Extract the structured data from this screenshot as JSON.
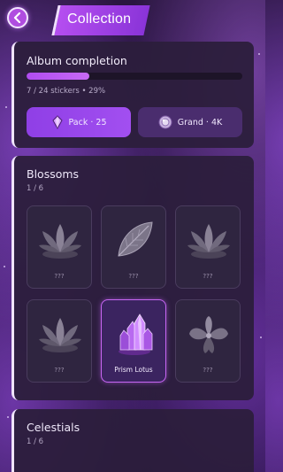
{
  "header": {
    "back_icon": "chevron-left-icon",
    "title": "Collection"
  },
  "album": {
    "title": "Album completion",
    "progress_text": "7 / 24 stickers • 29%",
    "progress_fraction": 0.29,
    "pack_button": {
      "icon": "crystal-icon",
      "label": "Pack · 25"
    },
    "grand_button": {
      "icon": "orb-icon",
      "label": "Grand · 4K"
    }
  },
  "sections": [
    {
      "title": "Blossoms",
      "count": "1 / 6",
      "items": [
        {
          "icon": "lotus-icon",
          "label": "???",
          "unlocked": false
        },
        {
          "icon": "leaf-icon",
          "label": "???",
          "unlocked": false
        },
        {
          "icon": "lotus-icon",
          "label": "???",
          "unlocked": false
        },
        {
          "icon": "lotus-icon",
          "label": "???",
          "unlocked": false
        },
        {
          "icon": "crystal-icon",
          "label": "Prism Lotus",
          "unlocked": true
        },
        {
          "icon": "orchid-icon",
          "label": "???",
          "unlocked": false
        }
      ]
    },
    {
      "title": "Celestials",
      "count": "1 / 6"
    }
  ],
  "colors": {
    "accent": "#b04cf0",
    "panel": "#2c1e3c",
    "locked_tile": "#2f2540"
  }
}
